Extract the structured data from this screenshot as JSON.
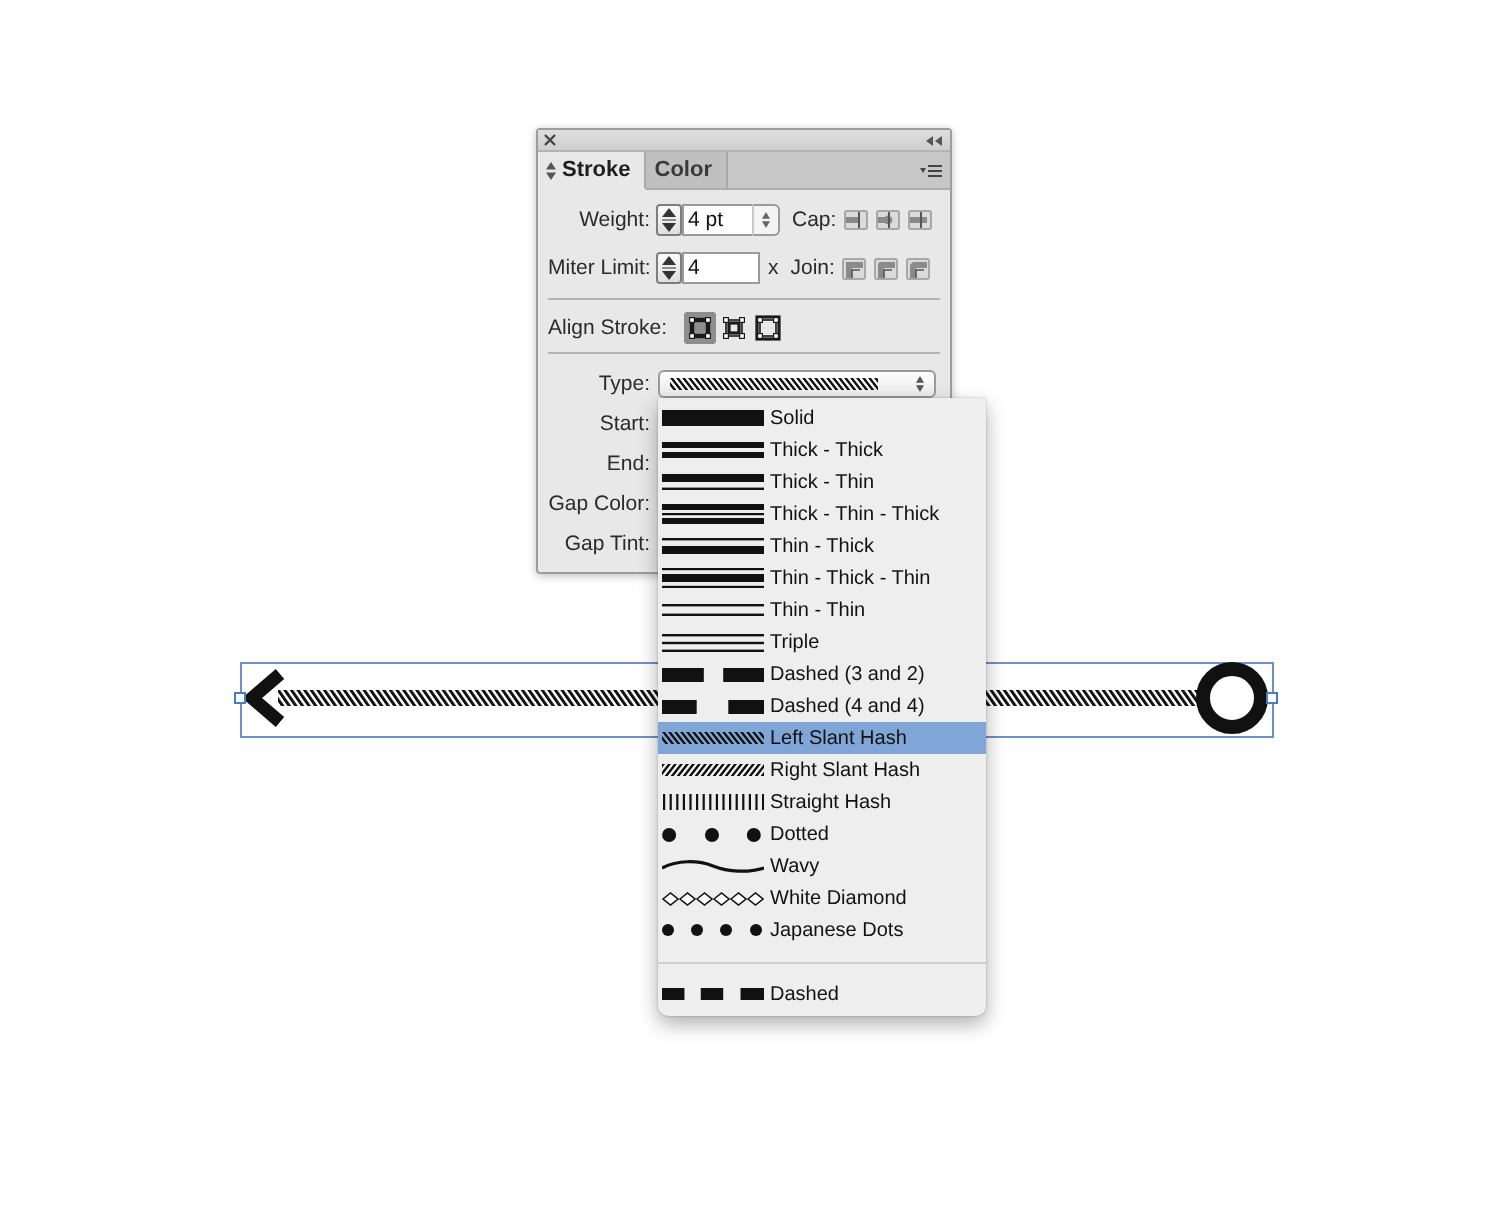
{
  "panel": {
    "tabs": [
      {
        "label": "Stroke",
        "selected": true
      },
      {
        "label": "Color",
        "selected": false
      }
    ],
    "weight": {
      "label": "Weight:",
      "value": "4 pt"
    },
    "cap": {
      "label": "Cap:"
    },
    "miter_limit": {
      "label": "Miter Limit:",
      "value": "4",
      "unit": "x"
    },
    "join": {
      "label": "Join:"
    },
    "align_stroke": {
      "label": "Align Stroke:",
      "options": [
        {
          "kind": "center",
          "selected": true
        },
        {
          "kind": "inside",
          "selected": false
        },
        {
          "kind": "outside",
          "selected": false
        }
      ]
    },
    "type": {
      "label": "Type:"
    },
    "rows": [
      {
        "label": "Start:"
      },
      {
        "label": "End:"
      },
      {
        "label": "Gap Color:"
      },
      {
        "label": "Gap Tint:"
      }
    ]
  },
  "type_menu": {
    "styles": [
      {
        "label": "Solid",
        "kind": "solid",
        "selected": false
      },
      {
        "label": "Thick - Thick",
        "kind": "thickthick",
        "selected": false
      },
      {
        "label": "Thick - Thin",
        "kind": "thickthin",
        "selected": false
      },
      {
        "label": "Thick - Thin - Thick",
        "kind": "thickthinthick",
        "selected": false
      },
      {
        "label": "Thin - Thick",
        "kind": "thinthick",
        "selected": false
      },
      {
        "label": "Thin - Thick - Thin",
        "kind": "thinthickthin",
        "selected": false
      },
      {
        "label": "Thin - Thin",
        "kind": "thinthin",
        "selected": false
      },
      {
        "label": "Triple",
        "kind": "triple",
        "selected": false
      },
      {
        "label": "Dashed (3 and 2)",
        "kind": "dashed32",
        "selected": false
      },
      {
        "label": "Dashed (4 and 4)",
        "kind": "dashed44",
        "selected": false
      },
      {
        "label": "Left Slant Hash",
        "kind": "leftslant",
        "selected": true
      },
      {
        "label": "Right Slant Hash",
        "kind": "rightslant",
        "selected": false
      },
      {
        "label": "Straight Hash",
        "kind": "straighthash",
        "selected": false
      },
      {
        "label": "Dotted",
        "kind": "dotted",
        "selected": false
      },
      {
        "label": "Wavy",
        "kind": "wavy",
        "selected": false
      },
      {
        "label": "White Diamond",
        "kind": "whitediamond",
        "selected": false
      },
      {
        "label": "Japanese Dots",
        "kind": "japanesedots",
        "selected": false
      }
    ],
    "custom_styles": [
      {
        "label": "Dashed",
        "kind": "dashed",
        "selected": false
      }
    ]
  }
}
